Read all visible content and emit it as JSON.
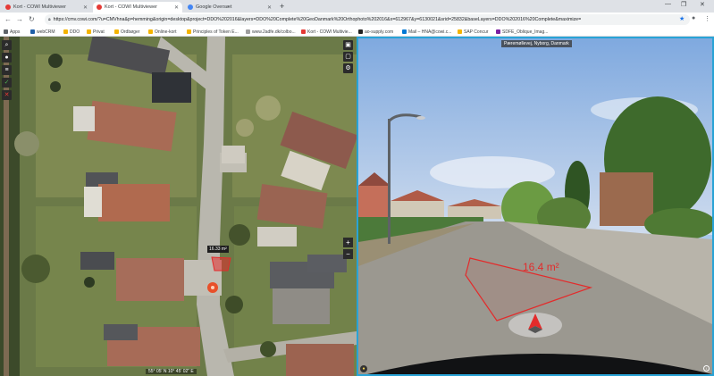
{
  "browser": {
    "tabs": [
      {
        "title": "Kort - COWI Multiviewer",
        "active": false
      },
      {
        "title": "Kort - COWI Multiviewer",
        "active": true
      },
      {
        "title": "Google Oversæt",
        "active": false
      }
    ],
    "new_tab_symbol": "+",
    "url": "https://cmv.cowi.com/?u=CMVhna&p=hemming&origin=desktop&project=DDO%202016&layers=DDO%20Complete%20GeoDanmark%20Orthophoto%202016&x=612967&y=6130021&srid=25832&baseLayers=DDO%202016%20Complete&maximize=",
    "bookmarks": [
      {
        "label": "Apps",
        "icon_color": "#5f6368"
      },
      {
        "label": "webCRM",
        "icon_color": "#1f5fa8"
      },
      {
        "label": "DDO",
        "icon_color": "#f4b400"
      },
      {
        "label": "Privat",
        "icon_color": "#f4b400"
      },
      {
        "label": "Ordbøger",
        "icon_color": "#f4b400"
      },
      {
        "label": "Online-kort",
        "icon_color": "#f4b400"
      },
      {
        "label": "Principles of Token E...",
        "icon_color": "#f4b400"
      },
      {
        "label": "www.2adfe.dk/colbo...",
        "icon_color": "#9e9e9e"
      },
      {
        "label": "Kort - COWI Multivie...",
        "icon_color": "#e53935"
      },
      {
        "label": "ao-supply.com",
        "icon_color": "#222222"
      },
      {
        "label": "Mail – HNA@cowi.c...",
        "icon_color": "#0078d4"
      },
      {
        "label": "SAP Concur",
        "icon_color": "#f4b400"
      },
      {
        "label": "SDFE_Oblique_Imag...",
        "icon_color": "#7b1fa2"
      }
    ]
  },
  "map": {
    "area_label": "16.33 m²",
    "coordinate_readout": "55° 05' N 10° 45' 02\" E",
    "left_tools": [
      {
        "name": "search-icon",
        "glyph": "⌕",
        "style": ""
      },
      {
        "name": "user-icon",
        "glyph": "●",
        "style": ""
      },
      {
        "name": "layers-icon",
        "glyph": "≡",
        "style": ""
      },
      {
        "name": "measure-check-icon",
        "glyph": "✓",
        "style": "green"
      },
      {
        "name": "close-tool-icon",
        "glyph": "✕",
        "style": "red"
      }
    ],
    "right_tools": [
      {
        "name": "camera-icon",
        "glyph": "▣"
      },
      {
        "name": "screen-icon",
        "glyph": "▢"
      },
      {
        "name": "settings-icon",
        "glyph": "⚙"
      }
    ],
    "zoom_in": "+",
    "zoom_out": "−"
  },
  "streetview": {
    "location_label": "Pæremøllevej, Nyborg, Danmark",
    "measurement": "16.4 m²"
  },
  "colors": {
    "accent_border": "#29a3d6",
    "measure_red": "#e32b2b"
  }
}
